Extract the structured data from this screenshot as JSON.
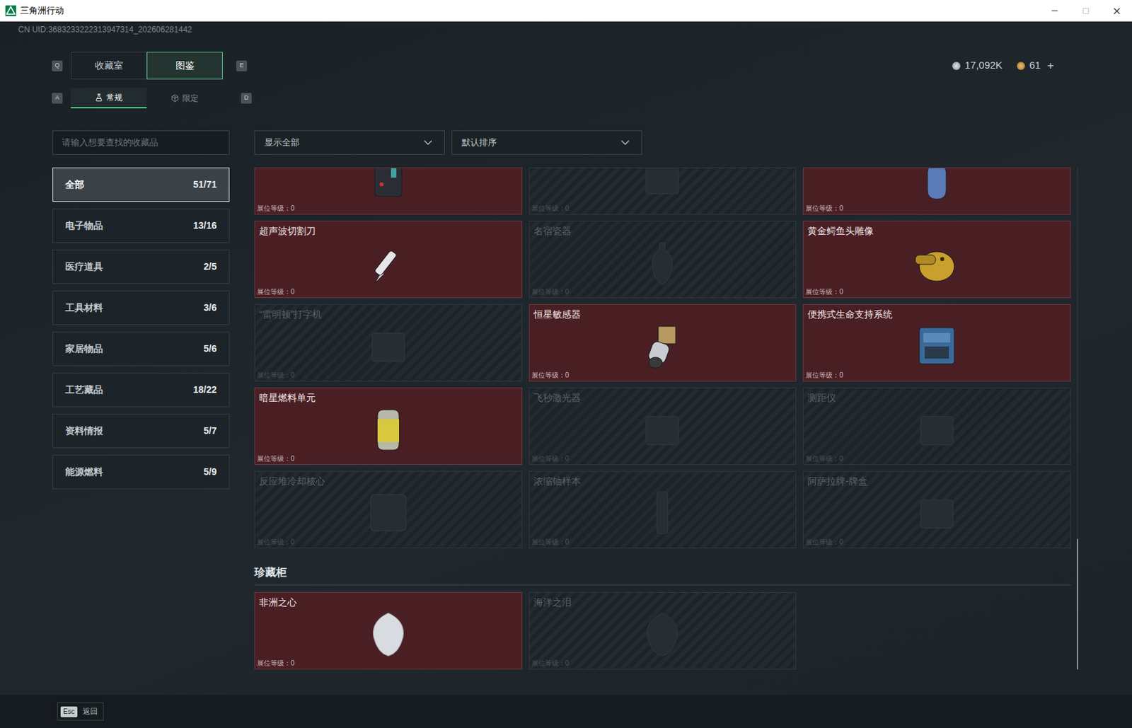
{
  "window": {
    "title": "三角洲行动",
    "controls": [
      "minimize",
      "maximize",
      "close"
    ]
  },
  "uid": "CN UID:3683233222313947314_202606281442",
  "currency": [
    {
      "value": "17,092K"
    },
    {
      "value": "61",
      "add": "+"
    }
  ],
  "main_tabs": {
    "prev_key": "Q",
    "next_key": "E",
    "items": [
      {
        "label": "收藏室",
        "selected": false
      },
      {
        "label": "图鉴",
        "selected": true
      }
    ]
  },
  "sub_tabs": {
    "prev_key": "A",
    "next_key": "D",
    "items": [
      {
        "label": "常规",
        "selected": true
      },
      {
        "label": "限定",
        "selected": false
      }
    ]
  },
  "search": {
    "placeholder": "请输入想要查找的收藏品"
  },
  "filters": [
    {
      "value": "显示全部"
    },
    {
      "value": "默认排序"
    }
  ],
  "categories": [
    {
      "label": "全部",
      "count": "51/71",
      "selected": true
    },
    {
      "label": "电子物品",
      "count": "13/16",
      "selected": false
    },
    {
      "label": "医疗道具",
      "count": "2/5",
      "selected": false
    },
    {
      "label": "工具材料",
      "count": "3/6",
      "selected": false
    },
    {
      "label": "家居物品",
      "count": "5/6",
      "selected": false
    },
    {
      "label": "工艺藏品",
      "count": "18/22",
      "selected": false
    },
    {
      "label": "资料情报",
      "count": "5/7",
      "selected": false
    },
    {
      "label": "能源燃料",
      "count": "5/9",
      "selected": false
    }
  ],
  "collection": {
    "partial_row": [
      {
        "collected": true,
        "level_label": "展位等级：0"
      },
      {
        "collected": false,
        "level_label": "展位等级：0"
      },
      {
        "collected": true,
        "level_label": "展位等级：0"
      }
    ],
    "items": [
      {
        "name": "超声波切割刀",
        "collected": true,
        "level_label": "展位等级：0"
      },
      {
        "name": "名宿瓷器",
        "collected": false,
        "level_label": "展位等级：0"
      },
      {
        "name": "黄金鳄鱼头雕像",
        "collected": true,
        "level_label": "展位等级：0"
      },
      {
        "name": "“雷明顿”打字机",
        "collected": false,
        "level_label": "展位等级：0"
      },
      {
        "name": "恒星敏感器",
        "collected": true,
        "level_label": "展位等级：0"
      },
      {
        "name": "便携式生命支持系统",
        "collected": true,
        "level_label": "展位等级：0"
      },
      {
        "name": "暗星燃料单元",
        "collected": true,
        "level_label": "展位等级：0"
      },
      {
        "name": "飞秒激光器",
        "collected": false,
        "level_label": "展位等级：0"
      },
      {
        "name": "测距仪",
        "collected": false,
        "level_label": "展位等级：0"
      },
      {
        "name": "反应堆冷却核心",
        "collected": false,
        "level_label": "展位等级：0"
      },
      {
        "name": "浓缩铀样本",
        "collected": false,
        "level_label": "展位等级：0"
      },
      {
        "name": "阿萨拉牌-牌盒",
        "collected": false,
        "level_label": "展位等级：0"
      }
    ]
  },
  "showcase": {
    "title": "珍藏柜",
    "items": [
      {
        "name": "非洲之心",
        "collected": true,
        "level_label": "展位等级：0"
      },
      {
        "name": "海洋之泪",
        "collected": false,
        "level_label": "展位等级：0"
      }
    ]
  },
  "scrollbar": {
    "level": 0.26
  },
  "footer": {
    "key": "Esc",
    "label": "返回"
  }
}
